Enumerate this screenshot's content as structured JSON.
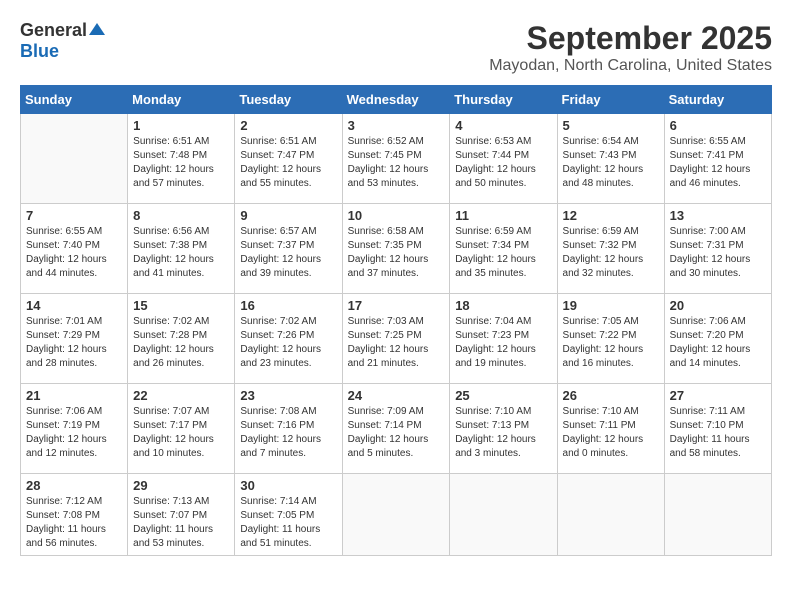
{
  "header": {
    "logo_general": "General",
    "logo_blue": "Blue",
    "month_year": "September 2025",
    "location": "Mayodan, North Carolina, United States"
  },
  "days_of_week": [
    "Sunday",
    "Monday",
    "Tuesday",
    "Wednesday",
    "Thursday",
    "Friday",
    "Saturday"
  ],
  "weeks": [
    [
      {
        "day": "",
        "content": ""
      },
      {
        "day": "1",
        "content": "Sunrise: 6:51 AM\nSunset: 7:48 PM\nDaylight: 12 hours\nand 57 minutes."
      },
      {
        "day": "2",
        "content": "Sunrise: 6:51 AM\nSunset: 7:47 PM\nDaylight: 12 hours\nand 55 minutes."
      },
      {
        "day": "3",
        "content": "Sunrise: 6:52 AM\nSunset: 7:45 PM\nDaylight: 12 hours\nand 53 minutes."
      },
      {
        "day": "4",
        "content": "Sunrise: 6:53 AM\nSunset: 7:44 PM\nDaylight: 12 hours\nand 50 minutes."
      },
      {
        "day": "5",
        "content": "Sunrise: 6:54 AM\nSunset: 7:43 PM\nDaylight: 12 hours\nand 48 minutes."
      },
      {
        "day": "6",
        "content": "Sunrise: 6:55 AM\nSunset: 7:41 PM\nDaylight: 12 hours\nand 46 minutes."
      }
    ],
    [
      {
        "day": "7",
        "content": "Sunrise: 6:55 AM\nSunset: 7:40 PM\nDaylight: 12 hours\nand 44 minutes."
      },
      {
        "day": "8",
        "content": "Sunrise: 6:56 AM\nSunset: 7:38 PM\nDaylight: 12 hours\nand 41 minutes."
      },
      {
        "day": "9",
        "content": "Sunrise: 6:57 AM\nSunset: 7:37 PM\nDaylight: 12 hours\nand 39 minutes."
      },
      {
        "day": "10",
        "content": "Sunrise: 6:58 AM\nSunset: 7:35 PM\nDaylight: 12 hours\nand 37 minutes."
      },
      {
        "day": "11",
        "content": "Sunrise: 6:59 AM\nSunset: 7:34 PM\nDaylight: 12 hours\nand 35 minutes."
      },
      {
        "day": "12",
        "content": "Sunrise: 6:59 AM\nSunset: 7:32 PM\nDaylight: 12 hours\nand 32 minutes."
      },
      {
        "day": "13",
        "content": "Sunrise: 7:00 AM\nSunset: 7:31 PM\nDaylight: 12 hours\nand 30 minutes."
      }
    ],
    [
      {
        "day": "14",
        "content": "Sunrise: 7:01 AM\nSunset: 7:29 PM\nDaylight: 12 hours\nand 28 minutes."
      },
      {
        "day": "15",
        "content": "Sunrise: 7:02 AM\nSunset: 7:28 PM\nDaylight: 12 hours\nand 26 minutes."
      },
      {
        "day": "16",
        "content": "Sunrise: 7:02 AM\nSunset: 7:26 PM\nDaylight: 12 hours\nand 23 minutes."
      },
      {
        "day": "17",
        "content": "Sunrise: 7:03 AM\nSunset: 7:25 PM\nDaylight: 12 hours\nand 21 minutes."
      },
      {
        "day": "18",
        "content": "Sunrise: 7:04 AM\nSunset: 7:23 PM\nDaylight: 12 hours\nand 19 minutes."
      },
      {
        "day": "19",
        "content": "Sunrise: 7:05 AM\nSunset: 7:22 PM\nDaylight: 12 hours\nand 16 minutes."
      },
      {
        "day": "20",
        "content": "Sunrise: 7:06 AM\nSunset: 7:20 PM\nDaylight: 12 hours\nand 14 minutes."
      }
    ],
    [
      {
        "day": "21",
        "content": "Sunrise: 7:06 AM\nSunset: 7:19 PM\nDaylight: 12 hours\nand 12 minutes."
      },
      {
        "day": "22",
        "content": "Sunrise: 7:07 AM\nSunset: 7:17 PM\nDaylight: 12 hours\nand 10 minutes."
      },
      {
        "day": "23",
        "content": "Sunrise: 7:08 AM\nSunset: 7:16 PM\nDaylight: 12 hours\nand 7 minutes."
      },
      {
        "day": "24",
        "content": "Sunrise: 7:09 AM\nSunset: 7:14 PM\nDaylight: 12 hours\nand 5 minutes."
      },
      {
        "day": "25",
        "content": "Sunrise: 7:10 AM\nSunset: 7:13 PM\nDaylight: 12 hours\nand 3 minutes."
      },
      {
        "day": "26",
        "content": "Sunrise: 7:10 AM\nSunset: 7:11 PM\nDaylight: 12 hours\nand 0 minutes."
      },
      {
        "day": "27",
        "content": "Sunrise: 7:11 AM\nSunset: 7:10 PM\nDaylight: 11 hours\nand 58 minutes."
      }
    ],
    [
      {
        "day": "28",
        "content": "Sunrise: 7:12 AM\nSunset: 7:08 PM\nDaylight: 11 hours\nand 56 minutes."
      },
      {
        "day": "29",
        "content": "Sunrise: 7:13 AM\nSunset: 7:07 PM\nDaylight: 11 hours\nand 53 minutes."
      },
      {
        "day": "30",
        "content": "Sunrise: 7:14 AM\nSunset: 7:05 PM\nDaylight: 11 hours\nand 51 minutes."
      },
      {
        "day": "",
        "content": ""
      },
      {
        "day": "",
        "content": ""
      },
      {
        "day": "",
        "content": ""
      },
      {
        "day": "",
        "content": ""
      }
    ]
  ]
}
